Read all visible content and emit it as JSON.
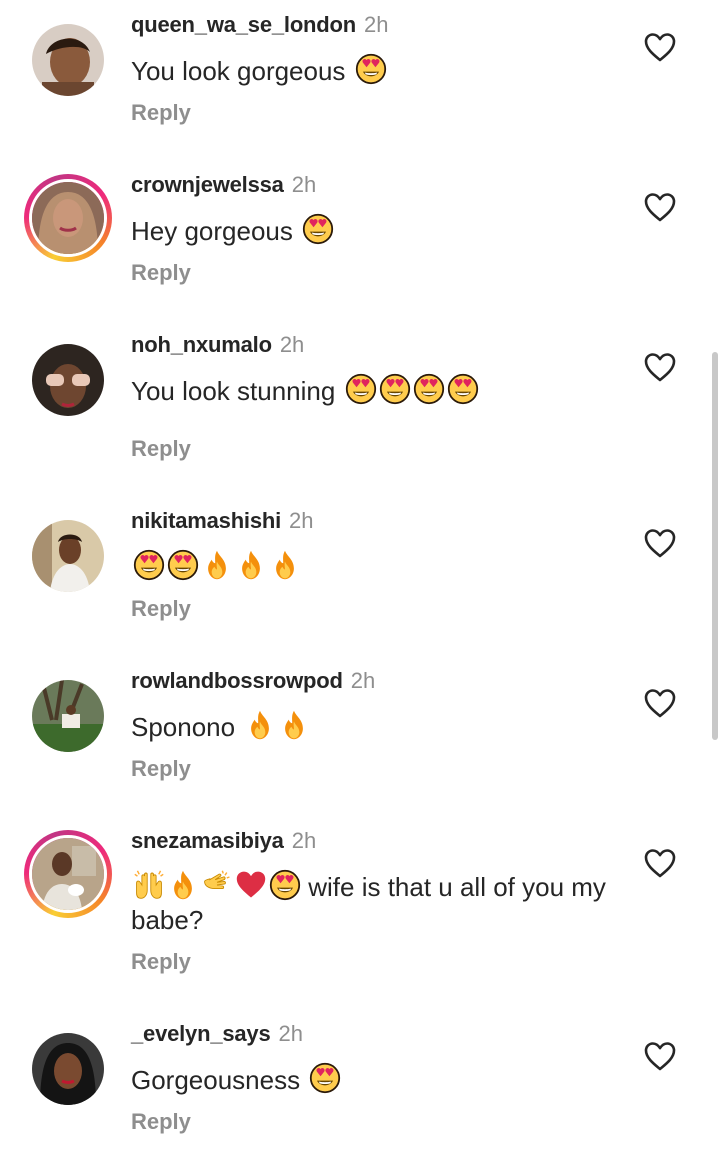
{
  "comments": [
    {
      "username": "queen_wa_se_london",
      "time": "2h",
      "text": "You look gorgeous",
      "emojis": [
        "heart-eyes"
      ],
      "reply": "Reply"
    },
    {
      "username": "crownjewelssa",
      "time": "2h",
      "text": "Hey gorgeous",
      "emojis": [
        "heart-eyes"
      ],
      "reply": "Reply"
    },
    {
      "username": "noh_nxumalo",
      "time": "2h",
      "text": "You look stunning",
      "emojis": [
        "heart-eyes",
        "heart-eyes",
        "heart-eyes",
        "heart-eyes"
      ],
      "reply": "Reply"
    },
    {
      "username": "nikitamashishi",
      "time": "2h",
      "text": "",
      "emojis": [
        "heart-eyes",
        "heart-eyes",
        "fire",
        "fire",
        "fire"
      ],
      "reply": "Reply"
    },
    {
      "username": "rowlandbossrowpod",
      "time": "2h",
      "text": "Sponono",
      "emojis": [
        "fire",
        "fire"
      ],
      "reply": "Reply"
    },
    {
      "username": "snezamasibiya",
      "time": "2h",
      "text_after_emojis": "wife is that u all of you my babe?",
      "emojis": [
        "raising-hands",
        "fire",
        "clapping-hands",
        "red-heart",
        "heart-eyes"
      ],
      "reply": "Reply"
    },
    {
      "username": "_evelyn_says",
      "time": "2h",
      "text": "Gorgeousness",
      "emojis": [
        "heart-eyes"
      ],
      "reply": "Reply"
    }
  ],
  "icons": {
    "like": "heart-outline-icon"
  },
  "colors": {
    "username": "#262626",
    "secondary": "#8e8e8e",
    "story_ring_start": "#f9ce34",
    "story_ring_mid": "#ee2a7b",
    "story_ring_end": "#c13584"
  }
}
